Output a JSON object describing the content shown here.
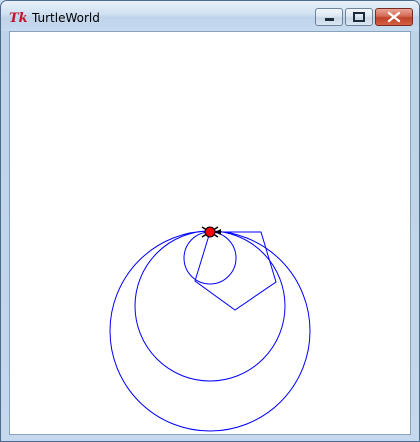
{
  "window": {
    "title": "TurtleWorld",
    "app_icon": "tk-feather-icon",
    "buttons": [
      "minimize-icon",
      "maximize-icon",
      "close-icon"
    ]
  },
  "canvas": {
    "background": "#ffffff",
    "stroke_color": "#0000ff",
    "turtle_color": "#ff0000"
  }
}
